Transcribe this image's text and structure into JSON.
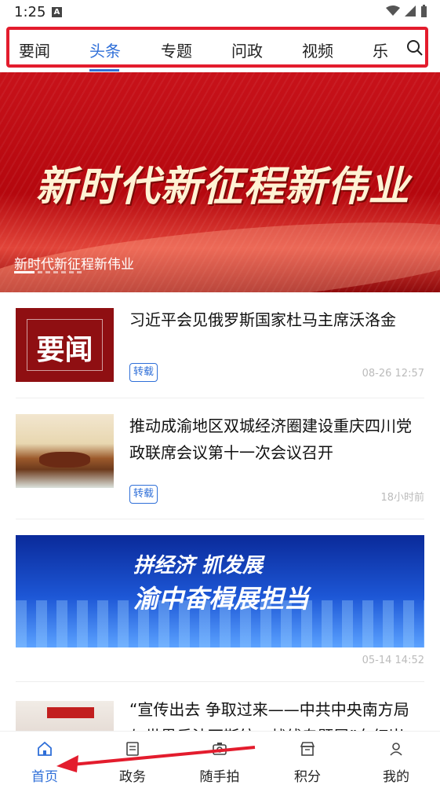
{
  "status": {
    "time": "1:25",
    "a_badge": "A"
  },
  "tabs": [
    "要闻",
    "头条",
    "专题",
    "问政",
    "视频",
    "乐"
  ],
  "active_tab_index": 1,
  "banner": {
    "headline": "新时代新征程新伟业",
    "caption": "新时代新征程新伟业"
  },
  "news": [
    {
      "title": "习近平会见俄罗斯国家杜马主席沃洛金",
      "tag": "转载",
      "time": "08-26 12:57",
      "thumb_text": "要闻"
    },
    {
      "title": "推动成渝地区双城经济圈建设重庆四川党政联席会议第十一次会议召开",
      "tag": "转载",
      "time": "18小时前"
    },
    {
      "banner_line1": "拼经济 抓发展",
      "banner_line2": "渝中奋楫展担当",
      "time": "05-14 14:52"
    },
    {
      "title": "“宣传出去 争取过来——中共中央南方局与世界反法西斯统一战线专题展”在红岩"
    }
  ],
  "tabbar": [
    "首页",
    "政务",
    "随手拍",
    "积分",
    "我的"
  ],
  "colors": {
    "accent": "#2f6fd8",
    "highlight": "#e31c2d",
    "arrow": "#e31c2d"
  }
}
